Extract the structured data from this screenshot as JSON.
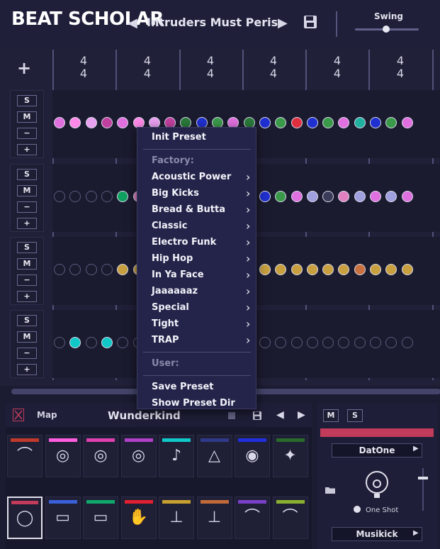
{
  "header": {
    "logo": "BEAT SCHOLAR",
    "preset_name": "Intruders Must Peris",
    "swing_label": "Swing",
    "swing_value": 0.5
  },
  "grid": {
    "add_label": "+",
    "time_signatures": [
      {
        "top": "4",
        "bottom": "4"
      },
      {
        "top": "4",
        "bottom": "4"
      },
      {
        "top": "4",
        "bottom": "4"
      },
      {
        "top": "4",
        "bottom": "4"
      },
      {
        "top": "4",
        "bottom": "4"
      },
      {
        "top": "4",
        "bottom": "4"
      }
    ],
    "row_controls": {
      "solo": "S",
      "mute": "M",
      "minus": "−",
      "plus": "+"
    }
  },
  "menu": {
    "init": "Init Preset",
    "factory_header": "Factory:",
    "factory_items": [
      "Acoustic Power",
      "Big Kicks",
      "Bread & Butta",
      "Classic",
      "Electro Funk",
      "Hip Hop",
      "In Ya Face",
      "Jaaaaaaz",
      "Special",
      "Tight",
      "TRAP"
    ],
    "user_header": "User:",
    "save": "Save Preset",
    "show_dir": "Show Preset Dir"
  },
  "bottom": {
    "map_label": "Map",
    "kit_name": "Wunderkind",
    "top_instruments": [
      {
        "color": "#c0392b",
        "icon": "cymbal-icon"
      },
      {
        "color": "#ff5de0",
        "icon": "drumset-icon"
      },
      {
        "color": "#e040b0",
        "icon": "drumset-icon"
      },
      {
        "color": "#b040c8",
        "icon": "drumset-icon"
      },
      {
        "color": "#10c8c8",
        "icon": "maracas-icon"
      },
      {
        "color": "#303a8a",
        "icon": "triangle-icon"
      },
      {
        "color": "#2030e0",
        "icon": "speaker-icon"
      },
      {
        "color": "#2a6a2a",
        "icon": "sparkle-icon"
      }
    ],
    "bottom_instruments": [
      {
        "color": "#c23b5a",
        "icon": "kick-icon"
      },
      {
        "color": "#3a60d8",
        "icon": "snare-icon"
      },
      {
        "color": "#10a86a",
        "icon": "snare-icon"
      },
      {
        "color": "#e02030",
        "icon": "clap-icon"
      },
      {
        "color": "#c8a030",
        "icon": "hihat-icon"
      },
      {
        "color": "#c06a3a",
        "icon": "hihat-icon"
      },
      {
        "color": "#7a40c8",
        "icon": "cymbal-icon"
      },
      {
        "color": "#8ab030",
        "icon": "cymbal-icon"
      }
    ]
  },
  "side": {
    "mute": "M",
    "solo": "S",
    "sample_name": "DatOne",
    "one_shot_label": "One Shot",
    "kit_select": "Musikick"
  }
}
